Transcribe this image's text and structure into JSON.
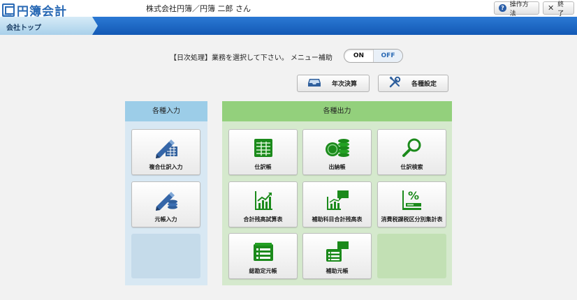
{
  "header": {
    "logo_text": "円簿会計",
    "user_name": "株式会社円簿／円簿 二郎 さん",
    "help_label": "操作方法",
    "exit_label": "終了"
  },
  "nav": {
    "active_tab": "会社トップ"
  },
  "instruction": {
    "text": "【日次処理】業務を選択して下さい。 メニュー補助",
    "toggle_on": "ON",
    "toggle_off": "OFF"
  },
  "actions": {
    "year_end": "年次決算",
    "settings": "各種設定"
  },
  "input_panel": {
    "title": "各種入力",
    "items": [
      "複合仕訳入力",
      "元帳入力"
    ]
  },
  "output_panel": {
    "title": "各種出力",
    "items": [
      "仕訳帳",
      "出納帳",
      "仕訳検索",
      "合計残高試算表",
      "補助科目合計残高表",
      "消費税課税区分別集計表",
      "総勘定元帳",
      "補助元帳"
    ]
  },
  "colors": {
    "accent_blue": "#1359b5",
    "icon_green": "#1b8a1b",
    "input_head": "#9ccde8",
    "output_head": "#93d07c"
  }
}
